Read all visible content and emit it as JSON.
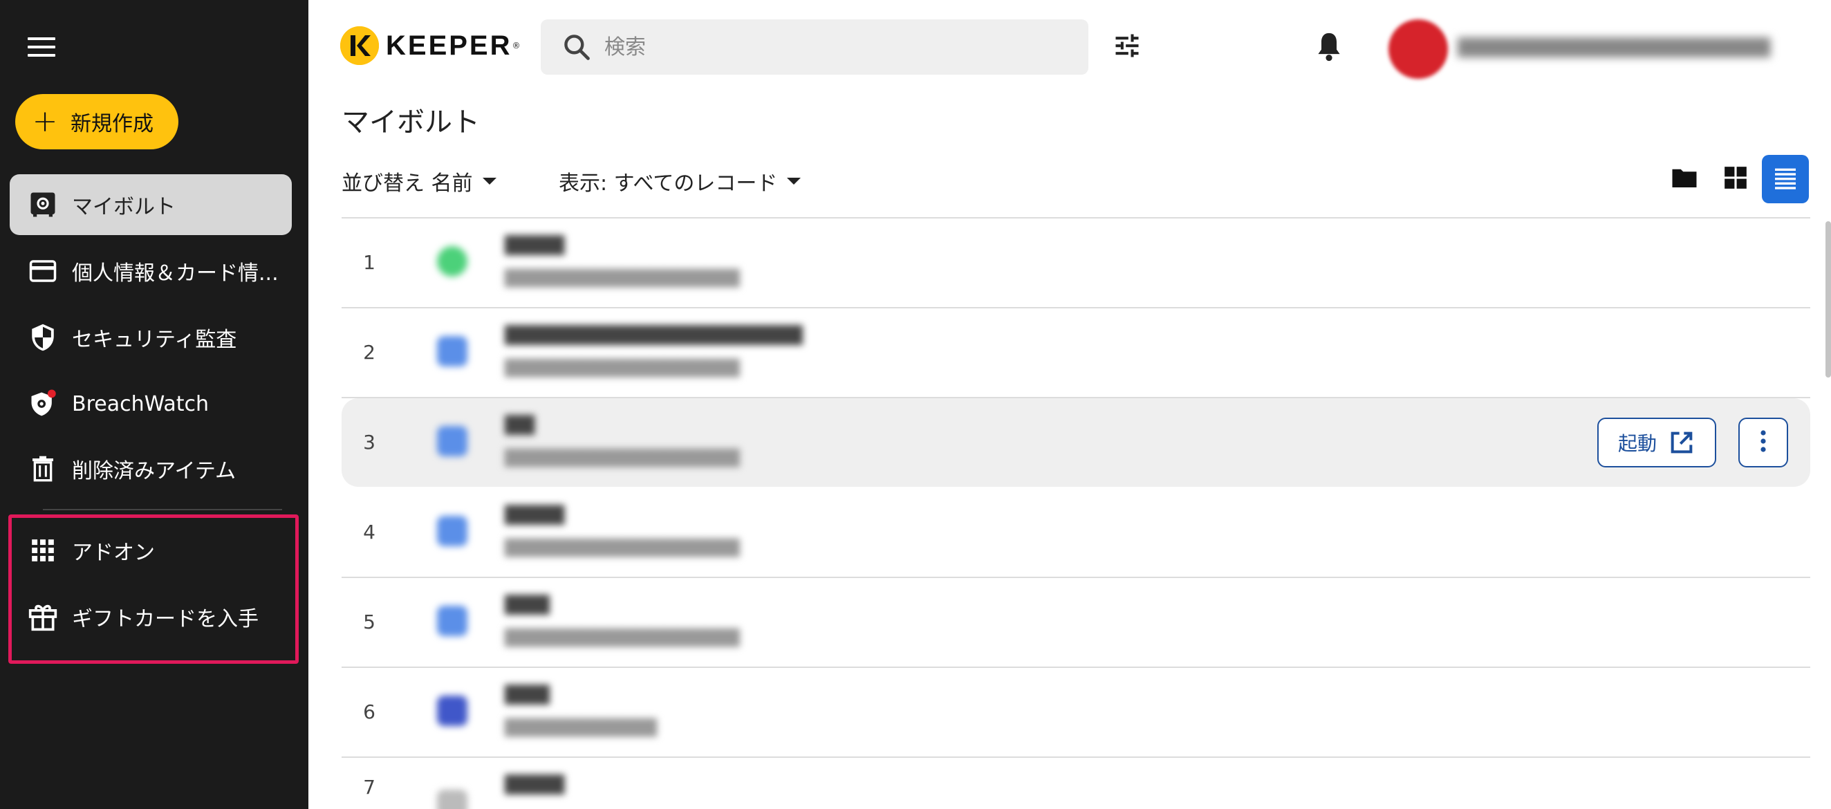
{
  "sidebar": {
    "new_button_label": "新規作成",
    "items": [
      {
        "label": "マイボルト",
        "icon": "vault-icon",
        "active": true
      },
      {
        "label": "個人情報＆カード情...",
        "icon": "credit-card-icon",
        "active": false
      },
      {
        "label": "セキュリティ監査",
        "icon": "shield-icon",
        "active": false
      },
      {
        "label": "BreachWatch",
        "icon": "breachwatch-icon",
        "active": false
      },
      {
        "label": "削除済みアイテム",
        "icon": "trash-icon",
        "active": false
      },
      {
        "label": "アドオン",
        "icon": "apps-grid-icon",
        "active": false
      },
      {
        "label": "ギフトカードを入手",
        "icon": "gift-icon",
        "active": false
      }
    ]
  },
  "header": {
    "logo_text": "KEEPER",
    "search_placeholder": "検索"
  },
  "main": {
    "title": "マイボルト",
    "sort_label": "並び替え 名前",
    "display_label": "表示: すべてのレコード",
    "rows": [
      {
        "num": "1",
        "icon_color": "#4cd17a"
      },
      {
        "num": "2",
        "icon_color": "#5b8fe8"
      },
      {
        "num": "3",
        "icon_color": "#5b8fe8"
      },
      {
        "num": "4",
        "icon_color": "#5b8fe8"
      },
      {
        "num": "5",
        "icon_color": "#5b8fe8"
      },
      {
        "num": "6",
        "icon_color": "#4057c9"
      },
      {
        "num": "7",
        "icon_color": "#bbbbbb"
      }
    ],
    "launch_label": "起動"
  },
  "colors": {
    "sidebar_bg": "#1b1b1b",
    "accent_yellow": "#ffc20e",
    "highlight_red": "#e0195a",
    "primary_blue": "#1f6fdb"
  }
}
